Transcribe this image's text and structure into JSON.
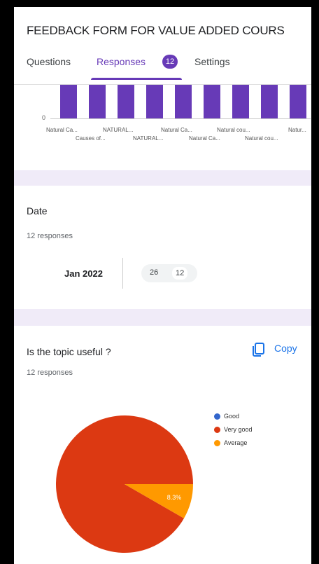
{
  "header": {
    "title": "FEEDBACK FORM FOR VALUE ADDED COURS",
    "tabs": [
      {
        "label": "Questions"
      },
      {
        "label": "Responses",
        "badge": "12"
      },
      {
        "label": "Settings"
      }
    ]
  },
  "bar_chart": {
    "zero_label": "0",
    "bar_count": 9,
    "xlabels_row1": [
      "Natural Ca...",
      "NATURAL...",
      "Natural Ca...",
      "Natural cou...",
      "Natur..."
    ],
    "xlabels_row2": [
      "Causes of...",
      "NATURAL...",
      "Natural Ca...",
      "Natural cou..."
    ]
  },
  "date_question": {
    "title": "Date",
    "responses": "12 responses",
    "month": "Jan 2022",
    "days": [
      "26",
      "12"
    ]
  },
  "topic_question": {
    "title": "Is the topic useful ?",
    "responses": "12 responses",
    "copy_label": "Copy",
    "chart_data": {
      "type": "pie",
      "legend": [
        "Good",
        "Very good",
        "Average"
      ],
      "colors": [
        "#3366cc",
        "#dc3912",
        "#ff9900"
      ],
      "values": [
        0,
        91.7,
        8.3
      ],
      "labels": [
        "",
        "91.7%",
        "8.3%"
      ],
      "legend_position": "right"
    }
  }
}
